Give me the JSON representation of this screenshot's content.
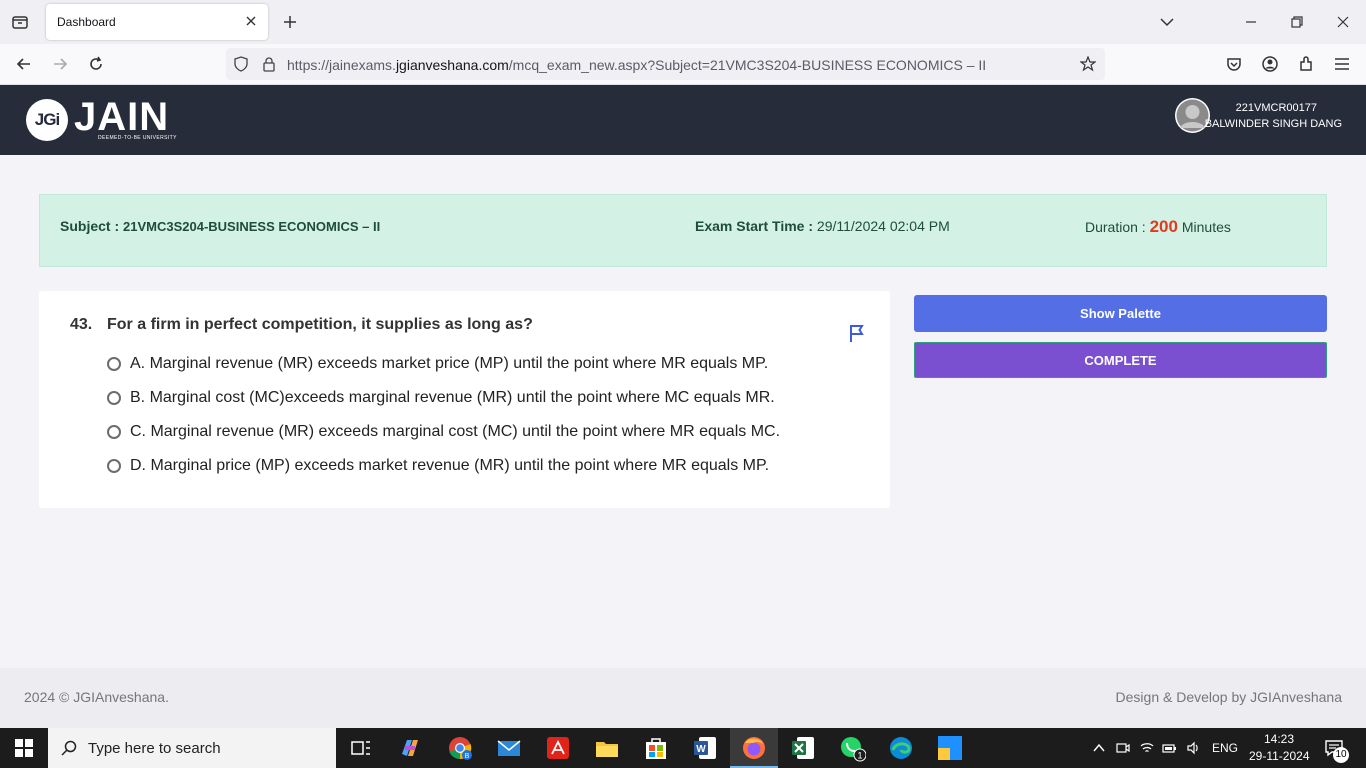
{
  "browser": {
    "tab_title": "Dashboard",
    "url_prefix": "https://jainexams.",
    "url_domain": "jgianveshana.com",
    "url_path": "/mcq_exam_new.aspx?Subject=21VMC3S204-BUSINESS ECONOMICS – II"
  },
  "header": {
    "logo_mark": "JGi",
    "logo_text": "JAIN",
    "logo_sub": "DEEMED-TO-BE UNIVERSITY",
    "user_id": "221VMCR00177",
    "user_name": "BALWINDER SINGH DANG"
  },
  "exam": {
    "subject_label": "Subject : ",
    "subject_value": "21VMC3S204-BUSINESS ECONOMICS – II",
    "start_label": "Exam Start Time : ",
    "start_value": "29/11/2024 02:04 PM",
    "duration_label": "Duration : ",
    "duration_value": "200",
    "duration_unit": " Minutes"
  },
  "question": {
    "number": "43.",
    "text": "For a firm in perfect competition, it supplies as long as?",
    "options": [
      "A. Marginal revenue (MR) exceeds market price (MP) until the point where MR equals MP.",
      "B. Marginal cost (MC)exceeds marginal revenue (MR) until the point where MC equals MR.",
      "C. Marginal revenue (MR) exceeds marginal cost (MC) until the point where MR equals MC.",
      "D. Marginal price (MP) exceeds market revenue (MR) until the point where MR equals MP."
    ]
  },
  "actions": {
    "show_palette": "Show Palette",
    "complete": "COMPLETE"
  },
  "footer": {
    "left": "2024 © JGIAnveshana.",
    "right": "Design & Develop by JGIAnveshana"
  },
  "taskbar": {
    "search_placeholder": "Type here to search",
    "language": "ENG",
    "time": "14:23",
    "date": "29-11-2024",
    "notification_count": "10",
    "whatsapp_badge": "1"
  },
  "colors": {
    "header_bg": "#272c3b",
    "banner_bg": "#d4f1e6",
    "palette_btn": "#546ee6",
    "complete_btn": "#7a4fd0",
    "duration_accent": "#e03b1f"
  }
}
